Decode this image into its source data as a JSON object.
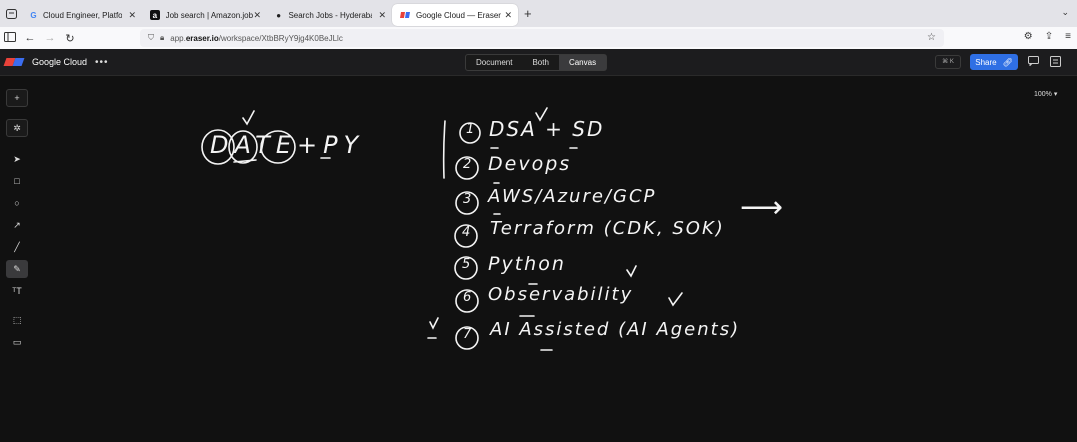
{
  "browser": {
    "tabs": [
      {
        "title": "Cloud Engineer, Platform and In",
        "icon": "google-icon",
        "active": false
      },
      {
        "title": "Job search | Amazon.jobs",
        "icon": "amazon-icon",
        "active": false
      },
      {
        "title": "Search Jobs - Hyderabad - Job:",
        "icon": "apple-icon",
        "active": false
      },
      {
        "title": "Google Cloud — Eraser",
        "icon": "eraser-icon",
        "active": true
      }
    ],
    "url_prefix": "app.",
    "url_host": "eraser.io",
    "url_path": "/workspace/XtbBRyY9jg4K0BeJLlc"
  },
  "app": {
    "name": "Google Cloud",
    "more": "•••",
    "views": [
      "Document",
      "Both",
      "Canvas"
    ],
    "selected_view": "Canvas",
    "shortcut": "⌘ K",
    "share_label": "Share",
    "zoom": "100% ▾"
  },
  "canvas": {
    "left_note": "DATE+PY",
    "items": [
      {
        "num": "1",
        "text": "DSA + SD"
      },
      {
        "num": "2",
        "text": "Devops"
      },
      {
        "num": "3",
        "text": "AWS/Azure/GCP"
      },
      {
        "num": "4",
        "text": "Terraform (CDK, SOK)"
      },
      {
        "num": "5",
        "text": "Python"
      },
      {
        "num": "6",
        "text": "Observability"
      },
      {
        "num": "7",
        "text": "AI Assisted (AI Agents)"
      }
    ],
    "arrow": "⟶"
  },
  "colors": {
    "accent": "#2f6fe4",
    "background": "#111111",
    "ink": "#f4f4f4"
  }
}
